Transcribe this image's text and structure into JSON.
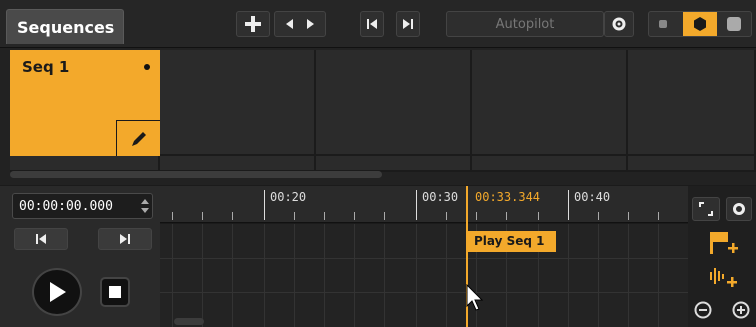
{
  "header": {
    "sequences_tab": "Sequences",
    "autopilot_label": "Autopilot"
  },
  "sequences": [
    {
      "name": "Seq 1"
    }
  ],
  "transport": {
    "time_value": "00:00:00.000"
  },
  "timeline": {
    "ruler_labels": [
      "00:20",
      "00:30",
      "00:40"
    ],
    "playhead_time": "00:33.344",
    "cue_label": "Play Seq 1"
  },
  "colors": {
    "accent": "#f3a92b"
  },
  "icons": [
    "plus-icon",
    "prev-icon",
    "next-icon",
    "skip-start-icon",
    "skip-end-icon",
    "gear-icon",
    "pencil-icon",
    "play-icon",
    "stop-icon",
    "flag-add-icon",
    "waveform-add-icon",
    "zoom-out-icon",
    "zoom-in-icon",
    "expand-icon"
  ]
}
